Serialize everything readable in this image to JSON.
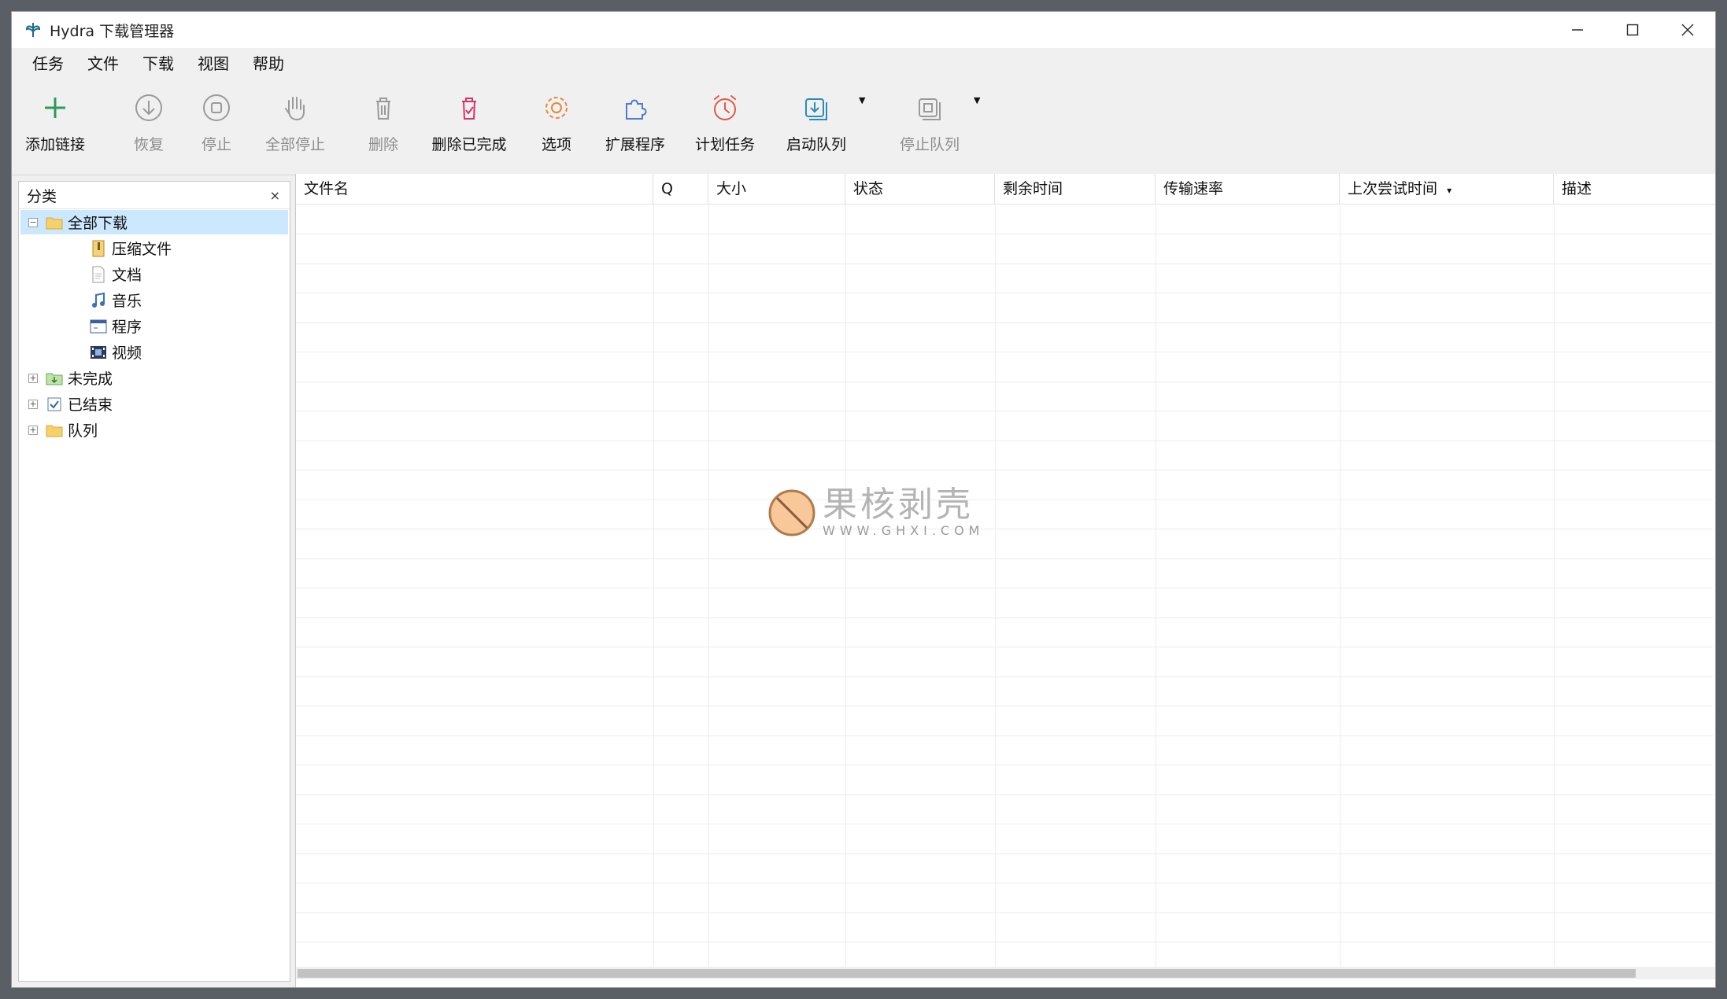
{
  "window": {
    "title": "Hydra 下载管理器"
  },
  "menu": [
    "任务",
    "文件",
    "下载",
    "视图",
    "帮助"
  ],
  "toolbar": {
    "add_link": "添加链接",
    "resume": "恢复",
    "stop": "停止",
    "stop_all": "全部停止",
    "delete": "删除",
    "delete_completed": "删除已完成",
    "options": "选项",
    "extensions": "扩展程序",
    "scheduler": "计划任务",
    "start_queue": "启动队列",
    "stop_queue": "停止队列"
  },
  "sidebar": {
    "header": "分类",
    "close": "×",
    "tree": {
      "all_downloads": "全部下载",
      "compressed": "压缩文件",
      "documents": "文档",
      "music": "音乐",
      "programs": "程序",
      "video": "视频",
      "unfinished": "未完成",
      "finished": "已结束",
      "queues": "队列"
    },
    "expanded_marker": "−",
    "collapsed_marker": "+"
  },
  "table": {
    "columns": [
      "文件名",
      "Q",
      "大小",
      "状态",
      "剩余时间",
      "传输速率",
      "上次尝试时间",
      "描述"
    ],
    "sort_indicator": "▾",
    "rows": []
  },
  "watermark": {
    "title": "果核剥壳",
    "subtitle": "WWW.GHXI.COM"
  },
  "colors": {
    "accent_green": "#2e9a5c",
    "selection": "#cce8ff",
    "options_orange": "#e08a3c",
    "extensions_blue": "#4a7fd0",
    "scheduler_red": "#e05a4a",
    "delete_completed_pink": "#d6336c",
    "queue_teal": "#2a8cb8"
  }
}
